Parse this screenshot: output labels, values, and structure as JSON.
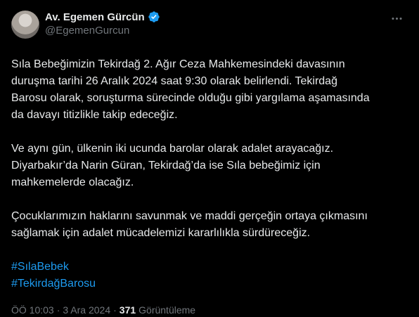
{
  "author": {
    "display_name": "Av. Egemen Gürcün",
    "handle": "@EgemenGurcun",
    "verified_color": "#1d9bf0"
  },
  "more_icon": "more-horizontal-icon",
  "tweet": {
    "paragraphs": [
      [
        "Sıla Bebeğimizin Tekirdağ 2. Ağır Ceza Mahkemesindeki davasının",
        "duruşma tarihi 26 Aralık 2024 saat 9:30 olarak belirlendi. Tekirdağ",
        "Barosu olarak, soruşturma sürecinde olduğu gibi yargılama aşamasında",
        "da davayı titizlikle takip edeceğiz."
      ],
      [
        "Ve aynı gün, ülkenin iki ucunda barolar olarak adalet arayacağız.",
        "Diyarbakır’da Narin Güran, Tekirdağ’da ise Sıla bebeğimiz için",
        "mahkemelerde olacağız."
      ],
      [
        "Çocuklarımızın haklarını savunmak ve maddi gerçeğin ortaya çıkmasını",
        "sağlamak için adalet mücadelemizi kararlılıkla sürdüreceğiz."
      ]
    ],
    "hashtags": [
      "#SılaBebek",
      "#TekirdağBarosu"
    ]
  },
  "meta": {
    "time": "ÖÖ 10:03",
    "separator": "·",
    "date": "3 Ara 2024",
    "views_count": "371",
    "views_label": "Görüntüleme"
  },
  "colors": {
    "background": "#000000",
    "text": "#e7e9ea",
    "secondary": "#71767b",
    "accent": "#1d9bf0"
  }
}
